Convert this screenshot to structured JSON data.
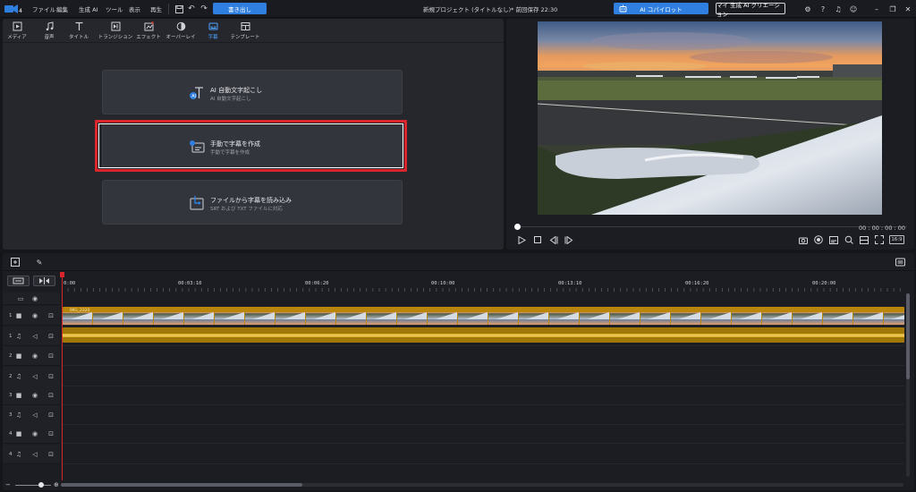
{
  "menu": {
    "items": [
      "ファイル",
      "編集",
      "生成 AI",
      "ツール",
      "表示",
      "再生"
    ],
    "export_label": "書き出し",
    "project_title": "新規プロジェクト (タイトルなし)* 前回保存 22:30",
    "ai_copilot_label": "AI コパイロット",
    "ai_creation_label": "マイ 生成 AI クリエーション"
  },
  "library": {
    "tabs": [
      "メディア",
      "音声",
      "タイトル",
      "トランジション",
      "エフェクト",
      "オーバーレイ",
      "字幕",
      "テンプレート"
    ],
    "active_tab": "字幕",
    "options": [
      {
        "title": "AI 自動文字起こし",
        "subtitle": "AI 自動文字起こし"
      },
      {
        "title": "手動で字幕を作成",
        "subtitle": "手動で字幕を作成"
      },
      {
        "title": "ファイルから字幕を読み込み",
        "subtitle": "SRT および TXT ファイルに対応"
      }
    ],
    "highlighted_option": "手動で字幕を作成"
  },
  "preview": {
    "timecode": "00 : 00 : 00 : 00",
    "aspect_ratio": "16:9",
    "playback_progress": 0
  },
  "timeline": {
    "ruler_labels": [
      "0:00",
      "00:03:10",
      "00:06:20",
      "00:10:00",
      "00:13:10",
      "00:16:20",
      "00:20:00"
    ],
    "clip_name": "IMG_2320",
    "tracks": [
      {
        "num": "1",
        "type": "video"
      },
      {
        "num": "1",
        "type": "audio"
      },
      {
        "num": "2",
        "type": "video"
      },
      {
        "num": "2",
        "type": "audio"
      },
      {
        "num": "3",
        "type": "video"
      },
      {
        "num": "3",
        "type": "audio"
      },
      {
        "num": "4",
        "type": "video"
      },
      {
        "num": "4",
        "type": "audio"
      }
    ]
  },
  "colors": {
    "accent": "#2f7fe0",
    "highlight": "#d9262c",
    "clip": "#b8860b"
  }
}
